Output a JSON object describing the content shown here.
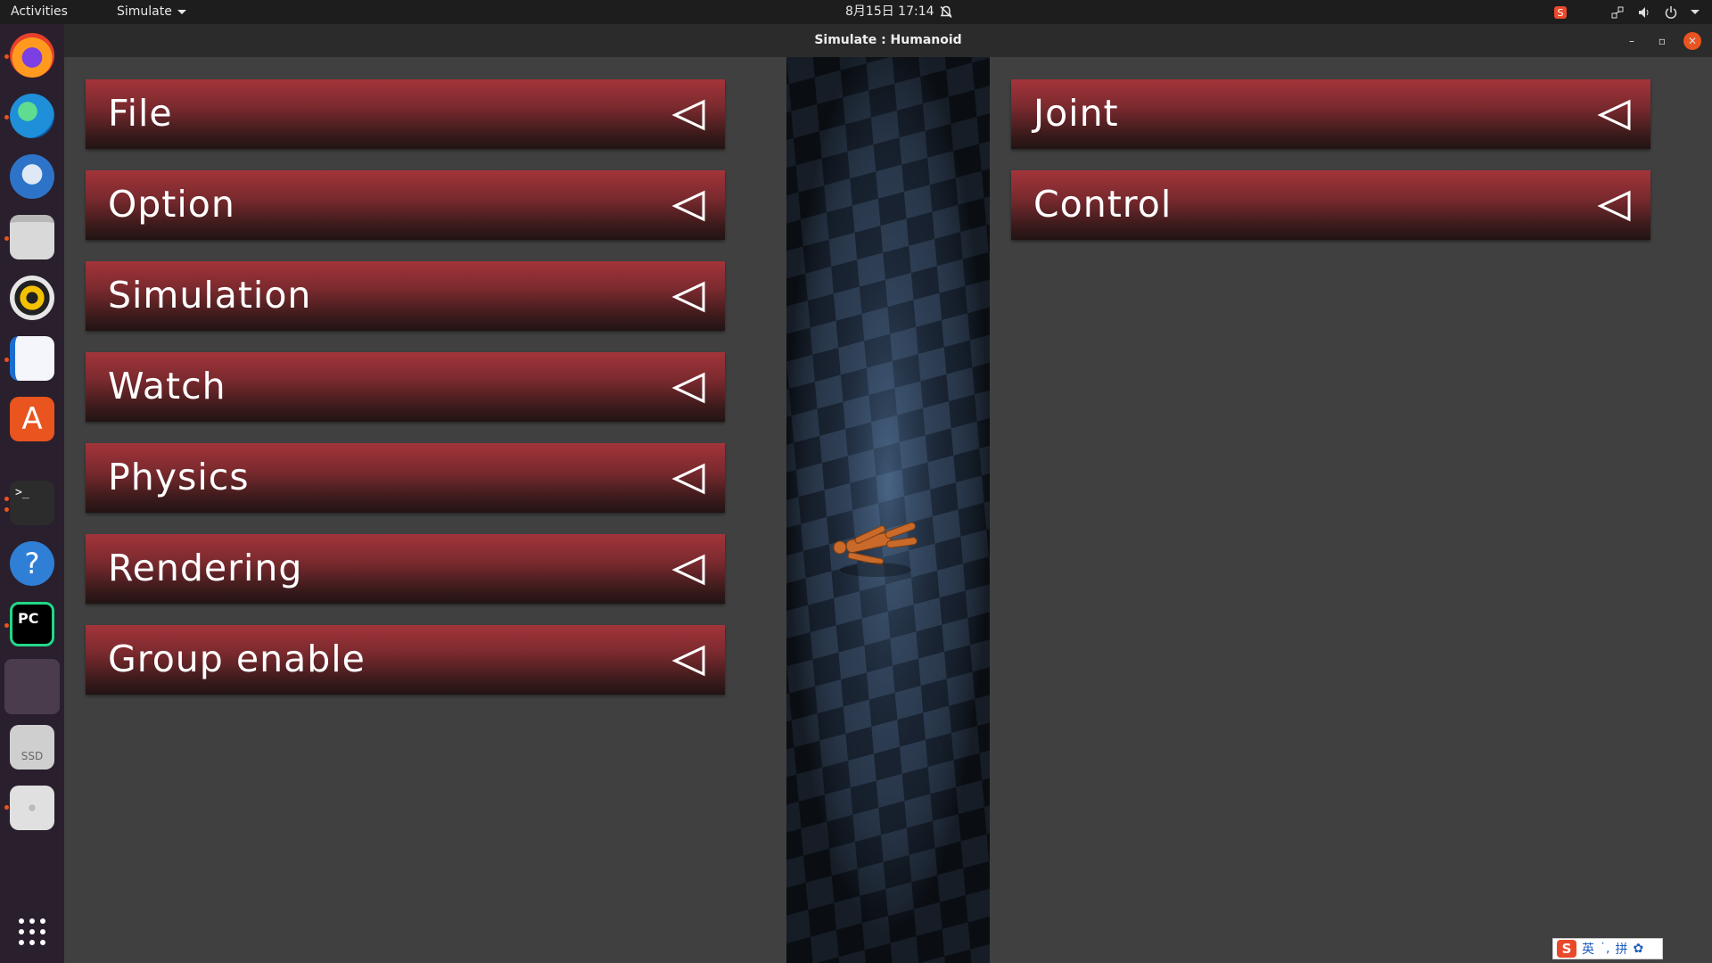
{
  "topbar": {
    "activities": "Activities",
    "app_menu": "Simulate",
    "clock": "8月15日  17:14"
  },
  "window": {
    "title": "Simulate : Humanoid",
    "minimize": "–",
    "maximize": "▫",
    "close": "✕"
  },
  "left_panel": {
    "sections": [
      {
        "label": "File"
      },
      {
        "label": "Option"
      },
      {
        "label": "Simulation"
      },
      {
        "label": "Watch"
      },
      {
        "label": "Physics"
      },
      {
        "label": "Rendering"
      },
      {
        "label": "Group enable"
      }
    ]
  },
  "right_panel": {
    "sections": [
      {
        "label": "Joint"
      },
      {
        "label": "Control"
      }
    ]
  },
  "ime": {
    "logo": "S",
    "mode": "英",
    "punct": "˙,",
    "input": "拼",
    "settings": "✿"
  },
  "colors": {
    "button_red": "#a3343a",
    "accent": "#e95420"
  },
  "dock": {
    "icons": [
      "firefox-icon",
      "edge-icon",
      "thunderbird-icon",
      "files-icon",
      "rhythmbox-icon",
      "writer-icon",
      "app-center-icon",
      "terminal-icon",
      "help-icon",
      "pycharm-icon",
      "active-app-icon",
      "ssd-drive-icon",
      "disc-drive-icon",
      "show-apps-icon"
    ]
  }
}
